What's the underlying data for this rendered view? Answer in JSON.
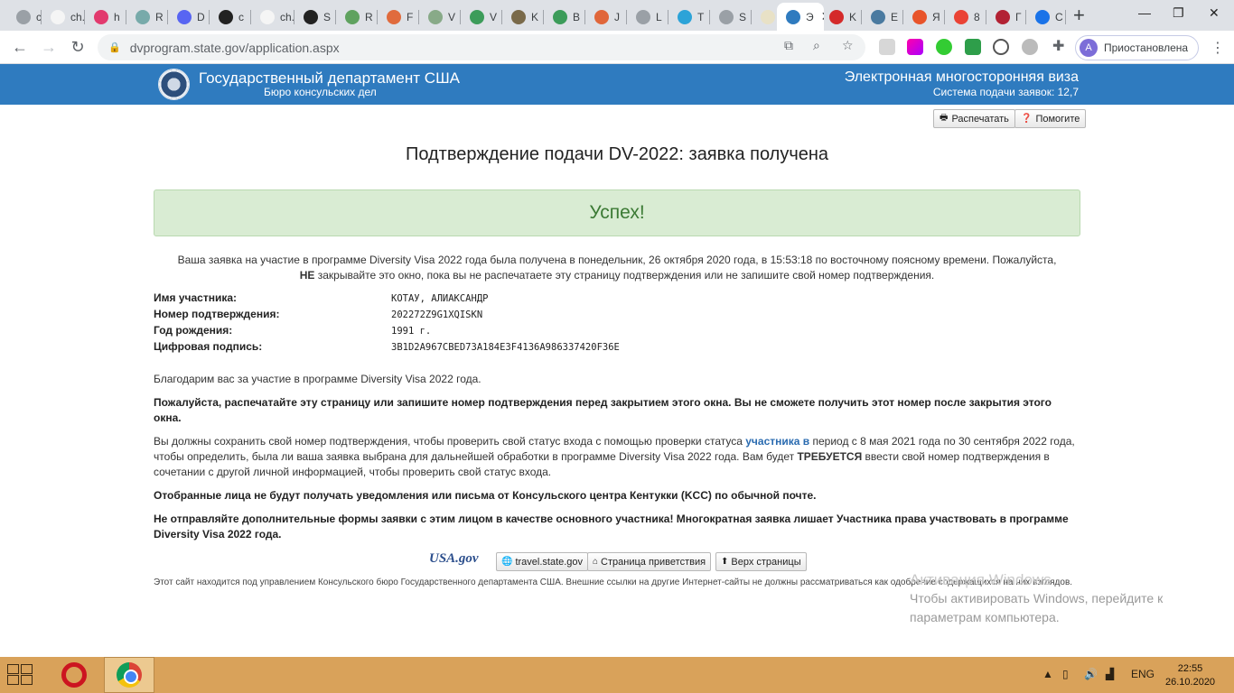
{
  "browser": {
    "tabs": [
      {
        "label": "ch. R",
        "color": "#9aa0a6"
      },
      {
        "label": "ch. R",
        "color": "#f5f5f5"
      },
      {
        "label": "h",
        "color": "#e23a6e"
      },
      {
        "label": "R",
        "color": "#7aa"
      },
      {
        "label": "D",
        "color": "#5865f2"
      },
      {
        "label": "c",
        "color": "#222"
      },
      {
        "label": "ch. R",
        "color": "#f5f5f5"
      },
      {
        "label": "S",
        "color": "#222"
      },
      {
        "label": "R",
        "color": "#5fa25f"
      },
      {
        "label": "F",
        "color": "#e06b3d"
      },
      {
        "label": "V",
        "color": "#8a8"
      },
      {
        "label": "V",
        "color": "#3c9c5a"
      },
      {
        "label": "K",
        "color": "#7a6a4a"
      },
      {
        "label": "B",
        "color": "#3c9c5a"
      },
      {
        "label": "J",
        "color": "#e0663a"
      },
      {
        "label": "L",
        "color": "#9aa0a6"
      },
      {
        "label": "T",
        "color": "#2ca3d8"
      },
      {
        "label": "S",
        "color": "#9aa0a6"
      },
      {
        "label": "D",
        "color": "#e8e1c6"
      },
      {
        "label": "Э",
        "color": "#2f7bbf",
        "active": true
      },
      {
        "label": "K",
        "color": "#d42a2a"
      },
      {
        "label": "E",
        "color": "#4a7aa0"
      },
      {
        "label": "Я",
        "color": "#e8542a"
      },
      {
        "label": "8",
        "color": "#ea4335"
      },
      {
        "label": "Г",
        "color": "#b22234"
      },
      {
        "label": "C",
        "color": "#1a73e8"
      }
    ],
    "url": "dvprogram.state.gov/application.aspx",
    "profile_initial": "A",
    "profile_label": "Приостановлена"
  },
  "header": {
    "department": "Государственный департамент США",
    "bureau": "Бюро консульских дел",
    "program": "Электронная многосторонняя виза",
    "system": "Система подачи заявок: 12,7"
  },
  "buttons": {
    "print": "Распечатать",
    "help": "Помогите"
  },
  "page_title": "Подтверждение подачи DV-2022: заявка получена",
  "success": "Успех!",
  "intro": {
    "part1": "Ваша заявка на участие в программе Diversity Visa 2022 года была получена в понедельник, 26 октября 2020 года, в 15:53:18 по восточному поясному времени. Пожалуйста,",
    "not_word": "НЕ",
    "part2": "закрывайте это окно, пока вы не распечатаете эту страницу подтверждения или не запишите свой номер подтверждения."
  },
  "fields": {
    "entrant_name_label": "Имя участника:",
    "entrant_name": "КОТАУ, АЛИАКСАНДР",
    "confirmation_label": "Номер подтверждения:",
    "confirmation": "202272Z9G1XQISKN",
    "birth_year_label": "Год рождения:",
    "birth_year": "1991 г.",
    "signature_label": "Цифровая подпись:",
    "signature": "3B1D2A967CBED73A184E3F4136A986337420F36E"
  },
  "paragraphs": {
    "thanks": "Благодарим вас за участие в программе Diversity Visa 2022 года.",
    "print_warning": "Пожалуйста, распечатайте эту страницу или запишите номер подтверждения перед закрытием этого окна. Вы не сможете получить этот номер после закрытия этого окна.",
    "status_part1": "Вы должны сохранить свой номер подтверждения, чтобы проверить свой статус входа с помощью проверки статуса",
    "status_link": "участника в",
    "status_part2": "период с 8 мая 2021 года по 30 сентября 2022 года, чтобы определить, была ли ваша заявка выбрана для дальнейшей обработки в программе Diversity Visa 2022 года. Вам будет",
    "required_word": "ТРЕБУЕТСЯ",
    "status_part3": "ввести свой номер подтверждения в сочетании с другой личной информацией, чтобы проверить свой статус входа.",
    "no_mail": "Отобранные лица не будут получать уведомления или письма от Консульского центра Кентукки (KCC) по обычной почте.",
    "no_additional": "Не отправляйте дополнительные формы заявки с этим лицом в качестве основного участника! Многократная заявка лишает Участника права участвовать в программе Diversity Visa 2022 года."
  },
  "footer": {
    "usa_logo": "USA.gov",
    "travel": "travel.state.gov",
    "home": "Страница приветствия",
    "top": "Верх страницы",
    "disclaimer": "Этот сайт находится под управлением Консульского бюро Государственного департамента США. Внешние ссылки на другие Интернет-сайты не должны рассматриваться как одобрение содержащихся на них взглядов."
  },
  "watermark": {
    "line1": "Активация Windows",
    "line2": "Чтобы активировать Windows, перейдите к",
    "line3": "параметрам компьютера."
  },
  "taskbar": {
    "language": "ENG",
    "time": "22:55",
    "date": "26.10.2020"
  }
}
